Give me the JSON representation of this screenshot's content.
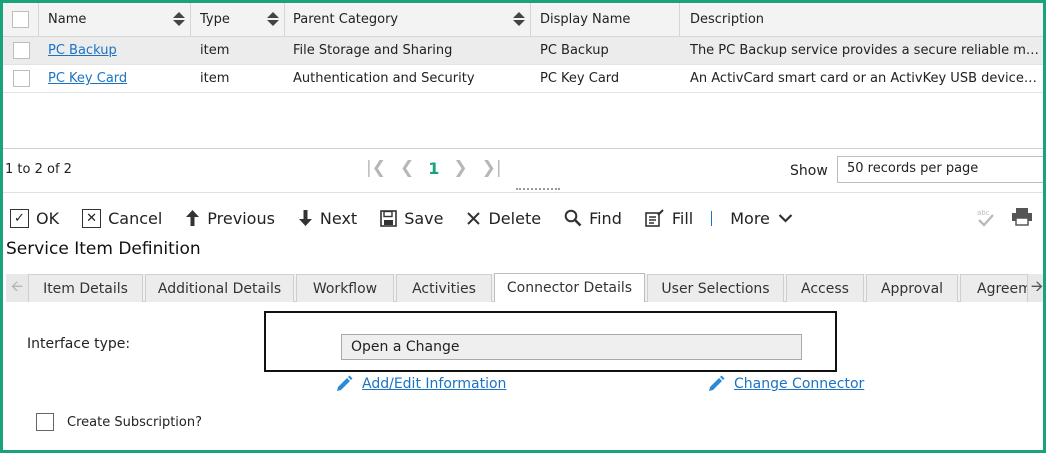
{
  "grid": {
    "columns": [
      "Name",
      "Type",
      "Parent Category",
      "Display Name",
      "Description"
    ],
    "rows": [
      {
        "name": "PC Backup",
        "type": "item",
        "parent_category": "File Storage and Sharing",
        "display_name": "PC Backup",
        "description": "The PC Backup service provides a secure reliable mean..."
      },
      {
        "name": "PC Key Card",
        "type": "item",
        "parent_category": "Authentication and Security",
        "display_name": "PC Key Card",
        "description": "An ActivCard smart card or an ActivKey USB device to..."
      }
    ]
  },
  "pager": {
    "count_text": "1 to 2 of 2",
    "current_page": "1",
    "show_label": "Show",
    "per_page_value": "50 records per page"
  },
  "toolbar": {
    "ok": "OK",
    "cancel": "Cancel",
    "previous": "Previous",
    "next": "Next",
    "save": "Save",
    "delete": "Delete",
    "find": "Find",
    "fill": "Fill",
    "more": "More"
  },
  "page_title": "Service Item Definition",
  "tabs": [
    {
      "label": "Item Details"
    },
    {
      "label": "Additional Details"
    },
    {
      "label": "Workflow"
    },
    {
      "label": "Activities"
    },
    {
      "label": "Connector Details",
      "active": true
    },
    {
      "label": "User Selections"
    },
    {
      "label": "Access"
    },
    {
      "label": "Approval"
    },
    {
      "label": "Agreem"
    }
  ],
  "connector": {
    "interface_label": "Interface type:",
    "interface_value": "Open a Change",
    "add_edit_link": "Add/Edit Information",
    "change_connector_link": "Change Connector",
    "create_subscription_label": "Create Subscription?"
  },
  "colors": {
    "frame": "#1aa37a",
    "link": "#1a73c4",
    "active_page": "#1aa37a"
  }
}
